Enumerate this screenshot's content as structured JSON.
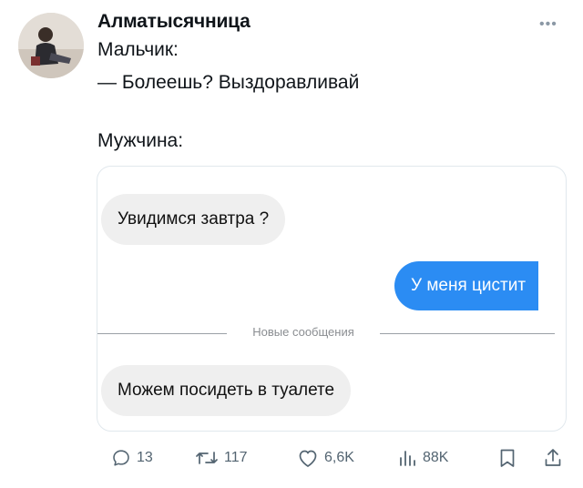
{
  "post": {
    "author": "Алматысячница",
    "more_icon": "more-horizontal-icon",
    "lines": [
      "Мальчик:",
      "— Болеешь? Выздоравливай",
      "Мужчина:"
    ]
  },
  "chat": {
    "msg_in_1": "Увидимся завтра ?",
    "msg_out": "У меня цистит",
    "divider": "Новые сообщения",
    "msg_in_2": "Можем посидеть в туалете"
  },
  "actions": {
    "replies": "13",
    "reposts": "117",
    "likes": "6,6K",
    "views": "88K"
  },
  "colors": {
    "outgoing": "#2b8cf3",
    "incoming": "#efefef",
    "icon": "#536471"
  }
}
